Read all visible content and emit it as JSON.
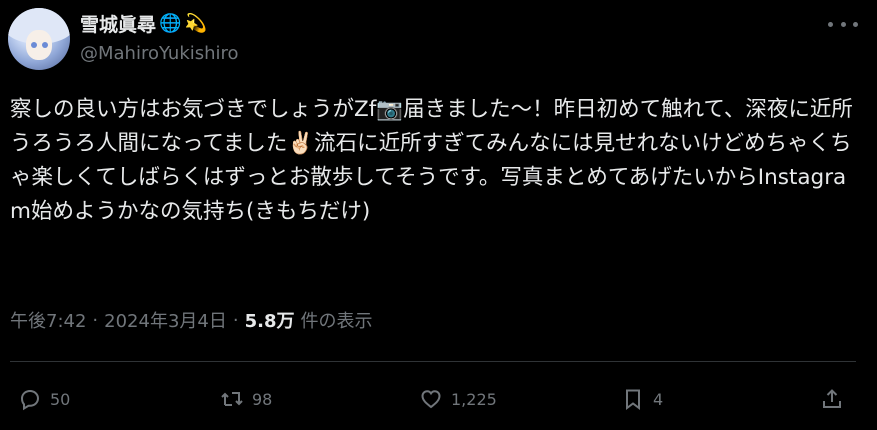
{
  "user": {
    "display_name": "雪城眞尋",
    "badges": [
      "🌐",
      "💫"
    ],
    "handle": "@MahiroYukishiro"
  },
  "tweet": {
    "text": "察しの良い方はお気づきでしょうがZf📷届きました〜！昨日初めて触れて、深夜に近所うろうろ人間になってました✌🏻流石に近所すぎてみんなには見せれないけどめちゃくちゃ楽しくてしばらくはずっとお散歩してそうです。写真まとめてあげたいからInstagram始めようかなの気持ち(きもちだけ)"
  },
  "meta": {
    "time": "午後7:42",
    "separator": "·",
    "date": "2024年3月4日",
    "views_count": "5.8万",
    "views_label": "件の表示"
  },
  "actions": {
    "replies": "50",
    "reposts": "98",
    "likes": "1,225",
    "bookmarks": "4"
  },
  "icons": [
    "more-icon",
    "reply-icon",
    "repost-icon",
    "like-icon",
    "bookmark-icon",
    "share-icon"
  ]
}
